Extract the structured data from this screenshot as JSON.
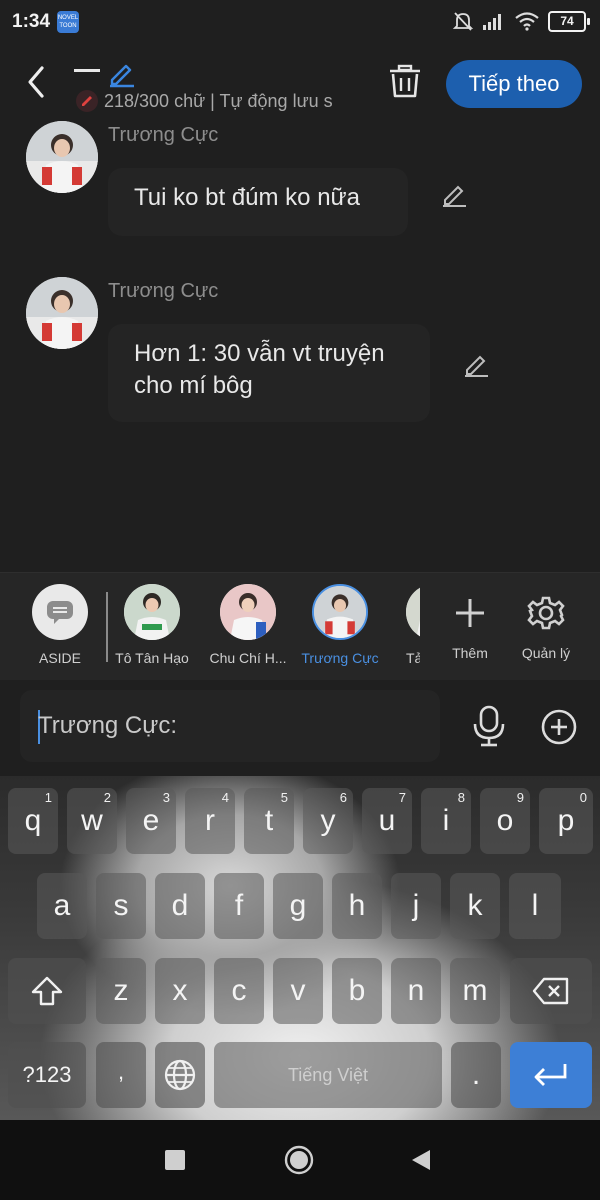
{
  "status_bar": {
    "time": "1:34",
    "app_badge": "NOVEL TOON",
    "battery": "74"
  },
  "header": {
    "word_count": "218/300 chữ | Tự động lưu s",
    "next_label": "Tiếp theo"
  },
  "messages": [
    {
      "name": "Trương Cực",
      "text": "Tui ko bt đúm ko nữa"
    },
    {
      "name": "Trương Cực",
      "text_line1": "Hơn 1: 30 vẫn vt truyện",
      "text_line2": "cho mí bôg"
    }
  ],
  "characters": {
    "aside": "ASIDE",
    "items": [
      "Tô Tân Hạo",
      "Chu Chí H...",
      "Trương Cực",
      "Tả"
    ],
    "add_label": "Thêm",
    "manage_label": "Quản lý"
  },
  "input": {
    "value": "Trương Cực:"
  },
  "keyboard": {
    "row1": [
      "q",
      "w",
      "e",
      "r",
      "t",
      "y",
      "u",
      "i",
      "o",
      "p"
    ],
    "row1_nums": [
      "1",
      "2",
      "3",
      "4",
      "5",
      "6",
      "7",
      "8",
      "9",
      "0"
    ],
    "row2": [
      "a",
      "s",
      "d",
      "f",
      "g",
      "h",
      "j",
      "k",
      "l"
    ],
    "row3": [
      "z",
      "x",
      "c",
      "v",
      "b",
      "n",
      "m"
    ],
    "mode_key": "?123",
    "comma": ",",
    "space_label": "Tiếng Việt",
    "period": "."
  },
  "colors": {
    "accent": "#1d5fae",
    "selected_char": "#4a90e2",
    "enter": "#3d7fd6"
  }
}
